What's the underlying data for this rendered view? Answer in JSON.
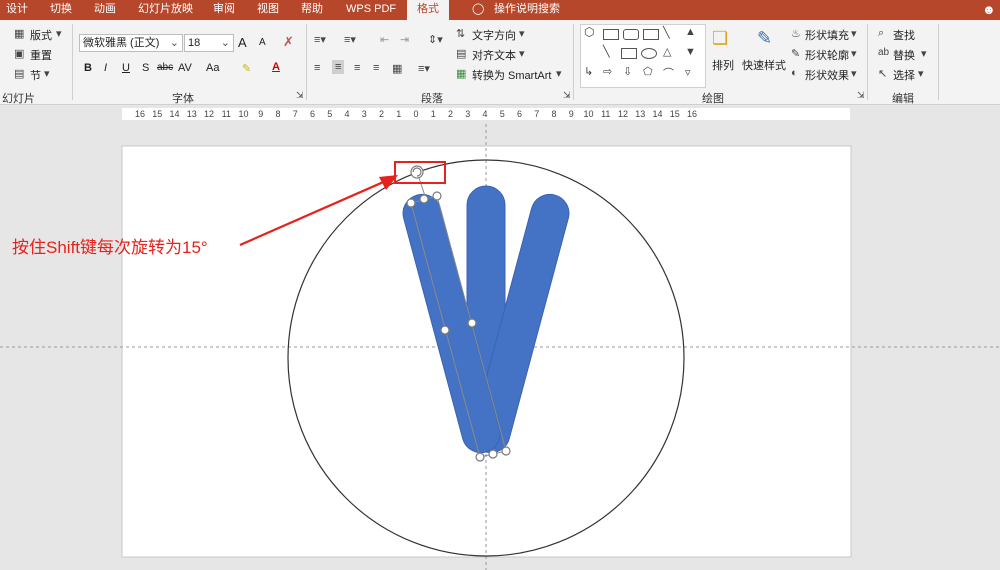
{
  "menu": {
    "tabs": [
      "设计",
      "切换",
      "动画",
      "幻灯片放映",
      "审阅",
      "视图",
      "帮助",
      "WPS PDF",
      "格式"
    ],
    "active_tab": "格式",
    "search_label": "操作说明搜索",
    "user_icon": "user-icon"
  },
  "ribbon": {
    "slides_group": {
      "layout_label": "版式",
      "reset_label": "重置",
      "section_label": "节",
      "group_label": "幻灯片"
    },
    "font_group": {
      "font_name": "微软雅黑 (正文)",
      "font_size": "18",
      "grow_label": "A",
      "shrink_label": "A",
      "bold": "B",
      "italic": "I",
      "underline": "U",
      "shadow": "S",
      "strikethrough": "abc",
      "spacing": "AV",
      "case": "Aa",
      "font_color": "A",
      "group_label": "字体"
    },
    "paragraph_group": {
      "text_direction_label": "文字方向",
      "align_text_label": "对齐文本",
      "smartart_label": "转换为 SmartArt",
      "group_label": "段落"
    },
    "drawing_group": {
      "arrange_label": "排列",
      "quick_styles_label": "快速样式",
      "fill_label": "形状填充",
      "outline_label": "形状轮廓",
      "effects_label": "形状效果",
      "group_label": "绘图"
    },
    "editing_group": {
      "find_label": "查找",
      "replace_label": "替换",
      "select_label": "选择",
      "group_label": "编辑"
    }
  },
  "ruler": {
    "labels": [
      "16",
      "15",
      "14",
      "13",
      "12",
      "11",
      "10",
      "9",
      "8",
      "7",
      "6",
      "5",
      "4",
      "3",
      "2",
      "1",
      "0",
      "1",
      "2",
      "3",
      "4",
      "5",
      "6",
      "7",
      "8",
      "9",
      "10",
      "11",
      "12",
      "13",
      "14",
      "15",
      "16"
    ]
  },
  "slide": {
    "annotation": "按住Shift键每次旋转为15°",
    "shape_color": "#4472c4",
    "annotation_color": "#e5221b"
  },
  "colors": {
    "accent": "#b7472a",
    "ribbon_bg": "#f3f3f3",
    "canvas_bg": "#e6e6e6"
  }
}
